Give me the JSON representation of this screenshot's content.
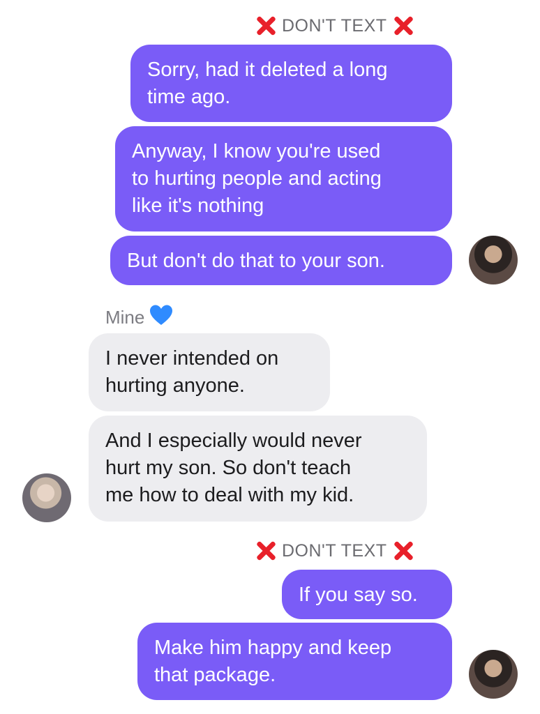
{
  "header1": {
    "label": "DON'T TEXT"
  },
  "header2": {
    "label": "DON'T TEXT"
  },
  "contact_name": "Mine",
  "messages": [
    {
      "text": "Sorry, had it deleted a long\ntime ago."
    },
    {
      "text": "Anyway, I know you're used\nto hurting people and acting\nlike it's nothing"
    },
    {
      "text": "But don't do that to your son."
    },
    {
      "text": "I never intended on\nhurting anyone."
    },
    {
      "text": "And I especially would never\nhurt my son. So don't teach\nme how to deal with my kid."
    },
    {
      "text": "If you say so."
    },
    {
      "text": "Make him happy and keep\nthat package."
    }
  ],
  "icons": {
    "x": "red-x-icon",
    "heart": "blue-heart-icon",
    "avatars": [
      "avatar-sender",
      "avatar-mine"
    ]
  },
  "colors": {
    "outgoing_bubble": "#7a5cf7",
    "incoming_bubble": "#ededf0",
    "x_icon": "#e8202a",
    "heart": "#2f8bff"
  }
}
